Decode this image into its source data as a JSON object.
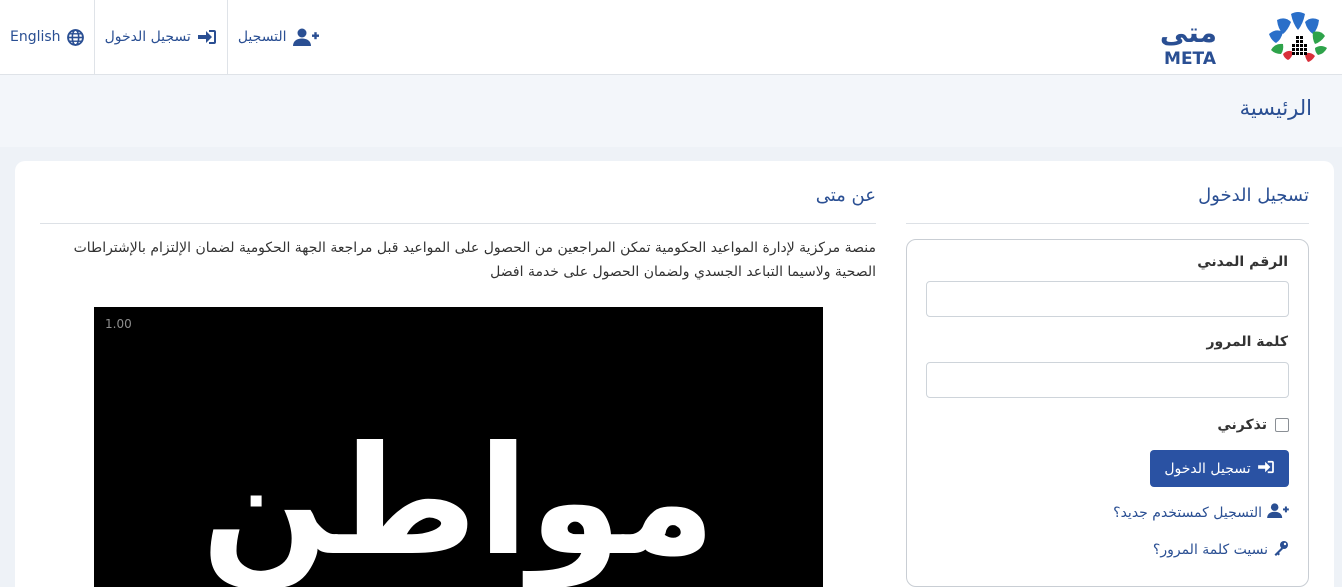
{
  "nav": {
    "language": "English",
    "login": "تسجيل الدخول",
    "register": "التسجيل"
  },
  "logo": {
    "arabic": "متى",
    "english": "META",
    "colors": {
      "blue": "#2a6fc9",
      "green": "#2ea34a",
      "red": "#d9303a",
      "navy": "#2a4f93"
    }
  },
  "page": {
    "title": "الرئيسية"
  },
  "login": {
    "title": "تسجيل الدخول",
    "civil_id_label": "الرقم المدني",
    "civil_id_value": "",
    "password_label": "كلمة المرور",
    "password_value": "",
    "remember_label": "تذكرني",
    "remember_checked": false,
    "submit_label": "تسجيل الدخول",
    "register_link": "التسجيل كمستخدم جديد؟",
    "forgot_link": "نسيت كلمة المرور؟"
  },
  "about": {
    "title": "عن متى",
    "text": "منصة مركزية لإدارة المواعيد الحكومية تمكن المراجعين من الحصول على المواعيد قبل مراجعة الجهة الحكومية لضمان الإلتزام بالإشتراطات الصحية ولاسيما التباعد الجسدي ولضمان الحصول على خدمة افضل"
  },
  "video": {
    "playback_speed": "1.00",
    "caption_word": "مواطن"
  },
  "colors": {
    "primary": "#2a4f93",
    "button": "#2a52a3",
    "band": "#f3f6fa",
    "background": "#eef2f7"
  }
}
